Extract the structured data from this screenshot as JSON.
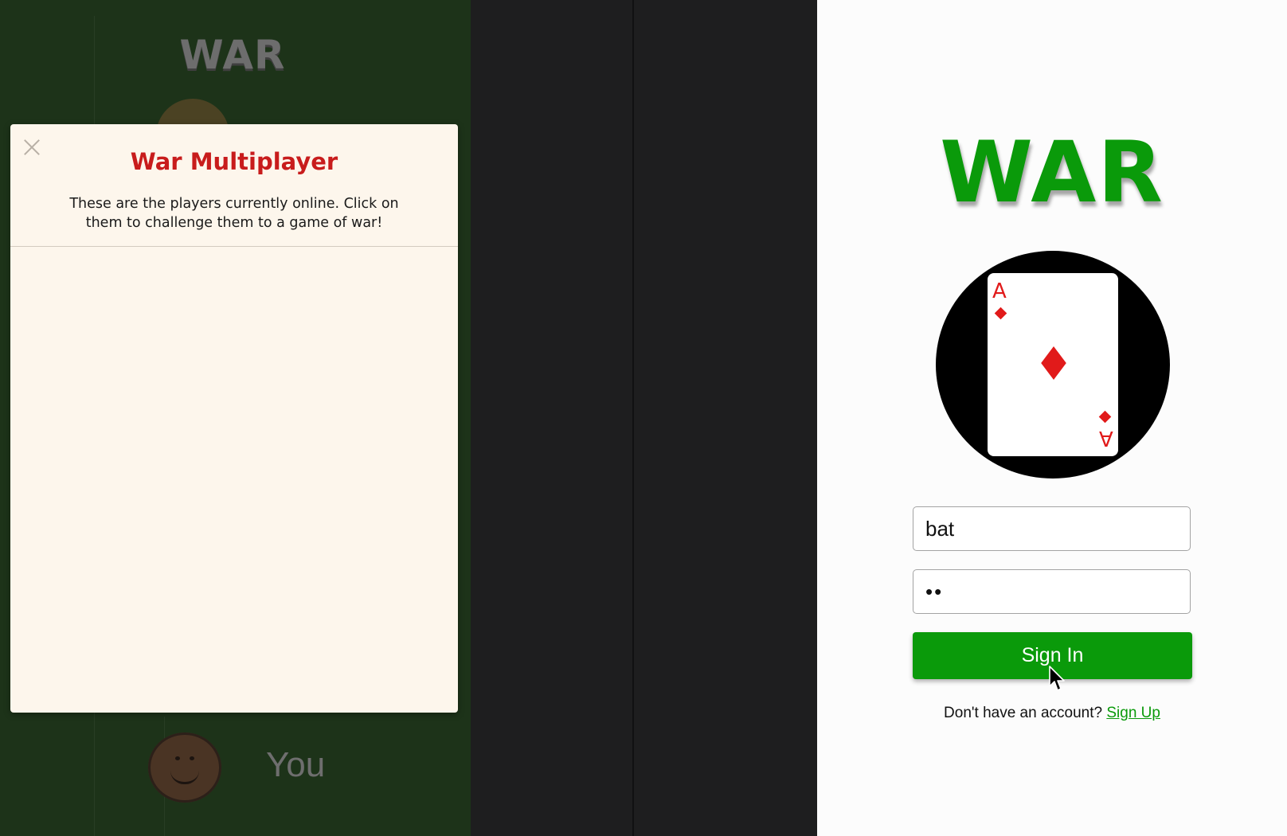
{
  "board": {
    "logo_text": "WAR",
    "you_label": "You"
  },
  "modal": {
    "title": "War Multiplayer",
    "description": "These are the players currently online. Click on them to challenge them to a game of war!",
    "players": []
  },
  "signin": {
    "logo_text": "WAR",
    "card": {
      "rank": "A",
      "suit": "diamonds"
    },
    "username_value": "bat",
    "password_value": "••",
    "submit_label": "Sign In",
    "signup_prompt": "Don't have an account?",
    "signup_link": "Sign Up"
  },
  "colors": {
    "accent_green": "#0a9a0a",
    "modal_title_red": "#c81c1c",
    "board_green": "#1d3319",
    "modal_bg": "#fdf6ec"
  }
}
